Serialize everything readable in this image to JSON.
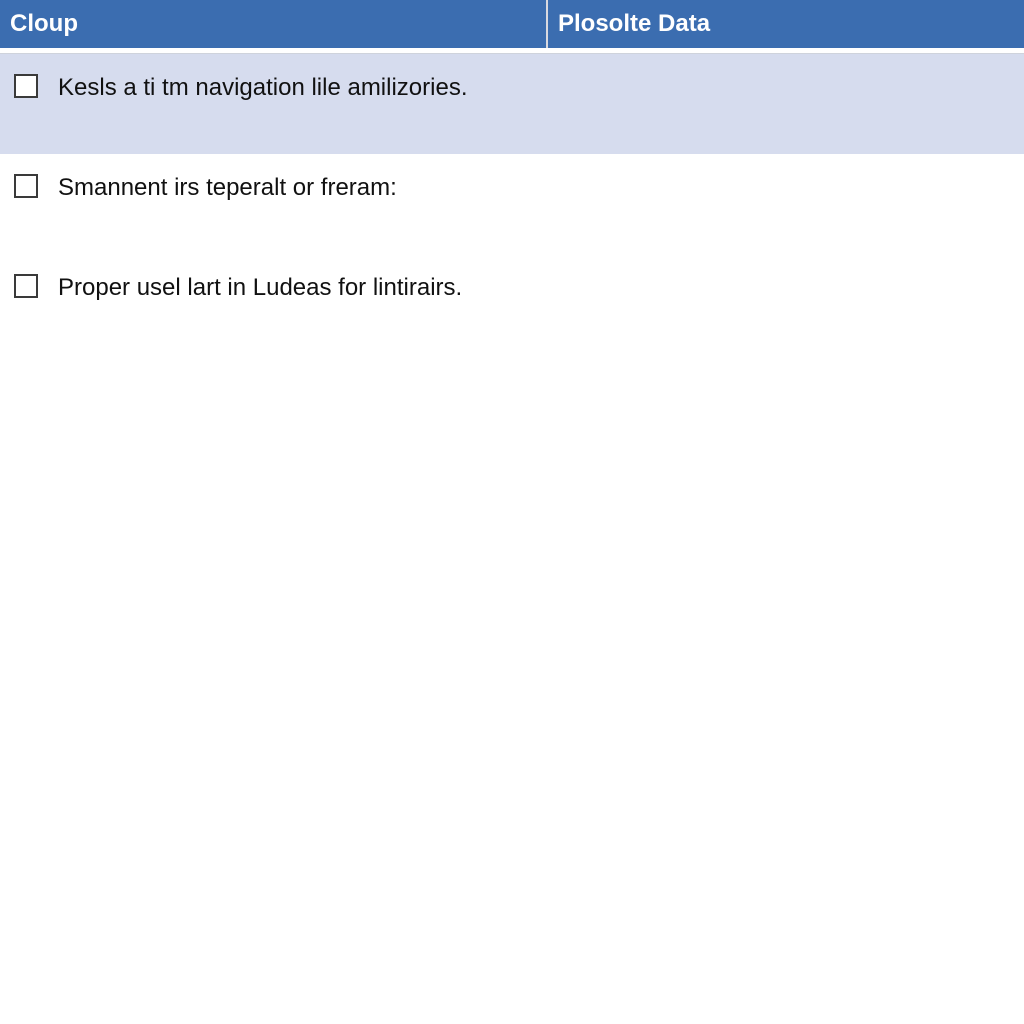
{
  "header": {
    "col1": "Cloup",
    "col2": "Plosolte Data"
  },
  "rows": [
    {
      "checked": false,
      "selected": true,
      "text": "Kesls a ti tm navigation lile amilizories."
    },
    {
      "checked": false,
      "selected": false,
      "text": "Smannent irs teperalt or freram:"
    },
    {
      "checked": false,
      "selected": false,
      "text": "Proper usel lart in Ludeas for lintirairs."
    }
  ]
}
